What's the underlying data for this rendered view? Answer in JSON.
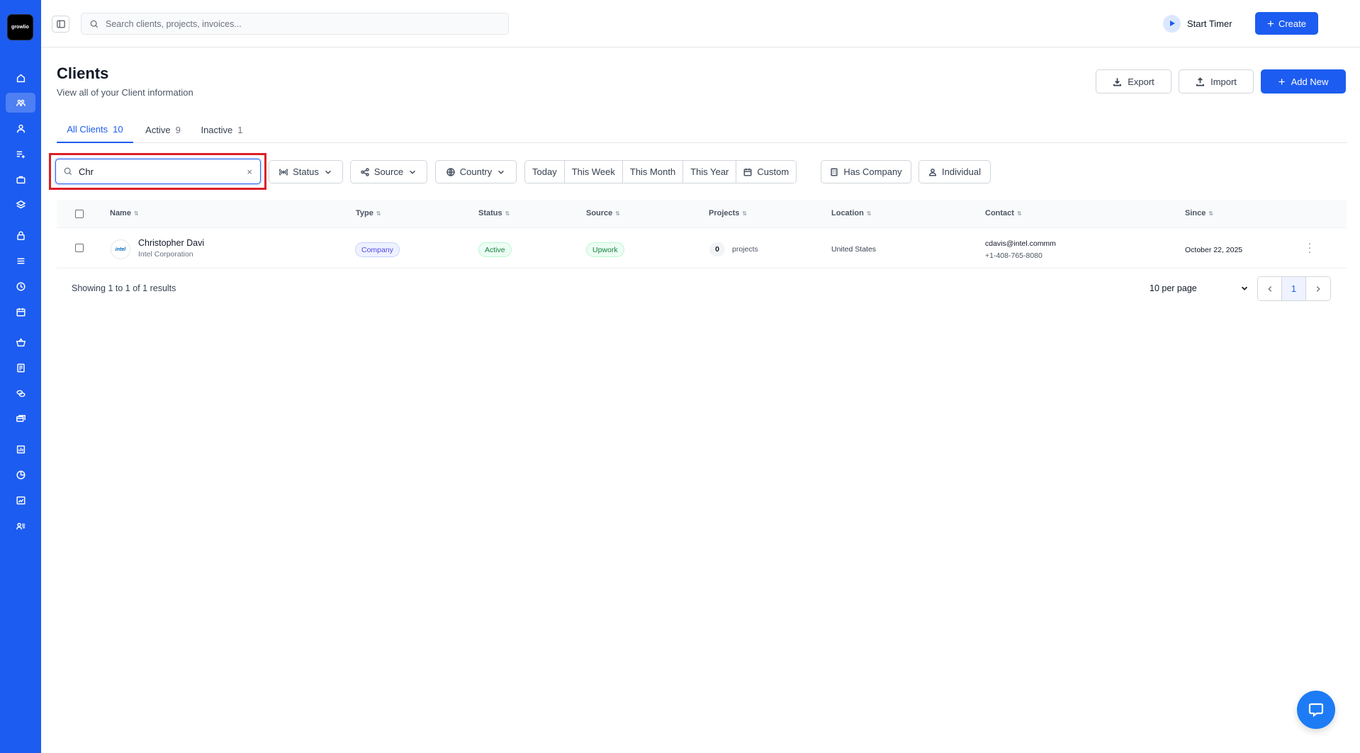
{
  "brand": {
    "logo_text": "growlio",
    "accent": "#1d5cf0",
    "highlight": "#dc1f26"
  },
  "sidebar": {
    "items": [
      {
        "name": "home-icon"
      },
      {
        "name": "clients-icon",
        "active": true
      },
      {
        "name": "user-icon"
      },
      {
        "name": "list-add-icon"
      },
      {
        "name": "briefcase-icon"
      },
      {
        "name": "layers-icon"
      },
      {
        "name": "lock-icon"
      },
      {
        "name": "menu-lines-icon"
      },
      {
        "name": "clock-icon"
      },
      {
        "name": "calendar-icon"
      },
      {
        "name": "basket-icon"
      },
      {
        "name": "invoice-icon"
      },
      {
        "name": "coins-icon"
      },
      {
        "name": "cards-icon"
      },
      {
        "name": "report-icon"
      },
      {
        "name": "pie-chart-icon"
      },
      {
        "name": "chart-icon"
      },
      {
        "name": "team-icon"
      }
    ]
  },
  "topbar": {
    "search_placeholder": "Search clients, projects, invoices...",
    "timer_label": "Start Timer",
    "create_label": "Create"
  },
  "header": {
    "title": "Clients",
    "subtitle": "View all of your Client information",
    "export_label": "Export",
    "import_label": "Import",
    "add_label": "Add New"
  },
  "tabs": [
    {
      "label": "All Clients",
      "count": "10"
    },
    {
      "label": "Active",
      "count": "9"
    },
    {
      "label": "Inactive",
      "count": "1"
    }
  ],
  "filters": {
    "search_value": "Chr",
    "clear_symbol": "×",
    "status": "Status",
    "source": "Source",
    "country": "Country",
    "dates": [
      "Today",
      "This Week",
      "This Month",
      "This Year",
      "Custom"
    ],
    "has_company": "Has Company",
    "individual": "Individual"
  },
  "table": {
    "columns": [
      "Name",
      "Type",
      "Status",
      "Source",
      "Projects",
      "Location",
      "Contact",
      "Since"
    ],
    "rows": [
      {
        "logo": "intel",
        "name": "Christopher Davi",
        "company": "Intel Corporation",
        "type": "Company",
        "status": "Active",
        "source": "Upwork",
        "projects": "0",
        "projects_label": "projects",
        "location": "United States",
        "email": "cdavis@intel.commm",
        "phone": "+1-408-765-8080",
        "since": "October 22, 2025"
      }
    ]
  },
  "footer": {
    "results_prefix": "Showing",
    "from": "1",
    "to_word": "to",
    "to": "1",
    "of_word": "of",
    "total": "1",
    "results_word": "results",
    "per_page": "10 per page",
    "current_page": "1"
  }
}
